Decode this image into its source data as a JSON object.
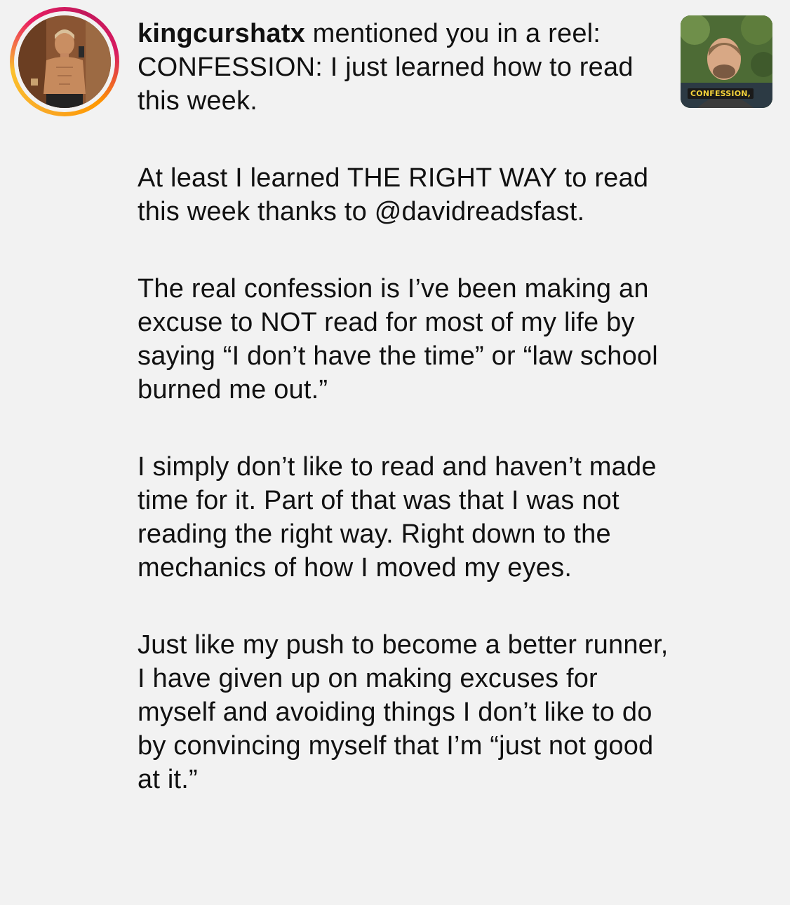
{
  "notification": {
    "username": "kingcurshatx",
    "action_text": " mentioned you in a reel:",
    "avatar_icon": "profile-photo",
    "thumbnail_icon": "reel-thumbnail",
    "thumbnail_caption": "CONFESSION,",
    "ring_colors": [
      "#f9a825",
      "#e91e63",
      "#c2185b",
      "#ff9800"
    ],
    "paragraphs": [
      "CONFESSION: I just learned how to read this week.",
      "At least I learned THE RIGHT WAY to read this week thanks to @davidreadsfast.",
      "The real confession is I’ve been making an excuse to NOT read for most of my life by saying “I don’t have the time” or “law school burned me out.”",
      "I simply don’t like to read and haven’t made time for it. Part of that was that I was not reading the right way. Right down to the mechanics of how I moved my eyes.",
      "Just like my push to become a better runner, I have given up on making excuses for myself and avoiding things I don’t like to do by convincing myself that I’m “just not good at it.”"
    ]
  }
}
